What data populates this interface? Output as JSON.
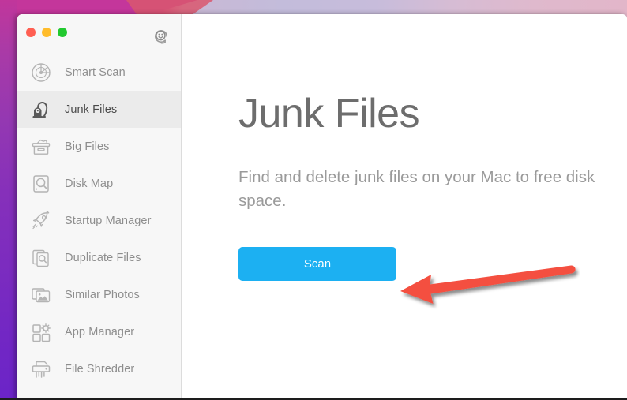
{
  "window": {
    "traffic_lights": [
      {
        "name": "close",
        "color": "#ff5f52"
      },
      {
        "name": "minimize",
        "color": "#ffbc2b"
      },
      {
        "name": "zoom",
        "color": "#22c92f"
      }
    ],
    "support_icon": "smiley-headset-icon"
  },
  "sidebar": {
    "items": [
      {
        "label": "Smart Scan",
        "icon": "radar-icon",
        "selected": false
      },
      {
        "label": "Junk Files",
        "icon": "vacuum-icon",
        "selected": true
      },
      {
        "label": "Big Files",
        "icon": "file-box-icon",
        "selected": false
      },
      {
        "label": "Disk Map",
        "icon": "disk-search-icon",
        "selected": false
      },
      {
        "label": "Startup Manager",
        "icon": "rocket-icon",
        "selected": false
      },
      {
        "label": "Duplicate Files",
        "icon": "copies-search-icon",
        "selected": false
      },
      {
        "label": "Similar Photos",
        "icon": "photos-stack-icon",
        "selected": false
      },
      {
        "label": "App Manager",
        "icon": "app-grid-gear-icon",
        "selected": false
      },
      {
        "label": "File Shredder",
        "icon": "shredder-icon",
        "selected": false
      }
    ]
  },
  "main": {
    "title": "Junk Files",
    "description": "Find and delete junk files on your Mac to free disk space.",
    "scan_label": "Scan"
  },
  "annotation": {
    "arrow": "left-pointing-arrow",
    "color": "#f4503f"
  },
  "colors": {
    "accent_button": "#1cb0f2",
    "sidebar_bg": "#f7f7f7",
    "selected_row": "#ebebeb",
    "title_text": "#6d6d6d",
    "desc_text": "#9a9a9a",
    "wallpaper_magenta": "#c4369b",
    "wallpaper_purple": "#6b24c8"
  }
}
